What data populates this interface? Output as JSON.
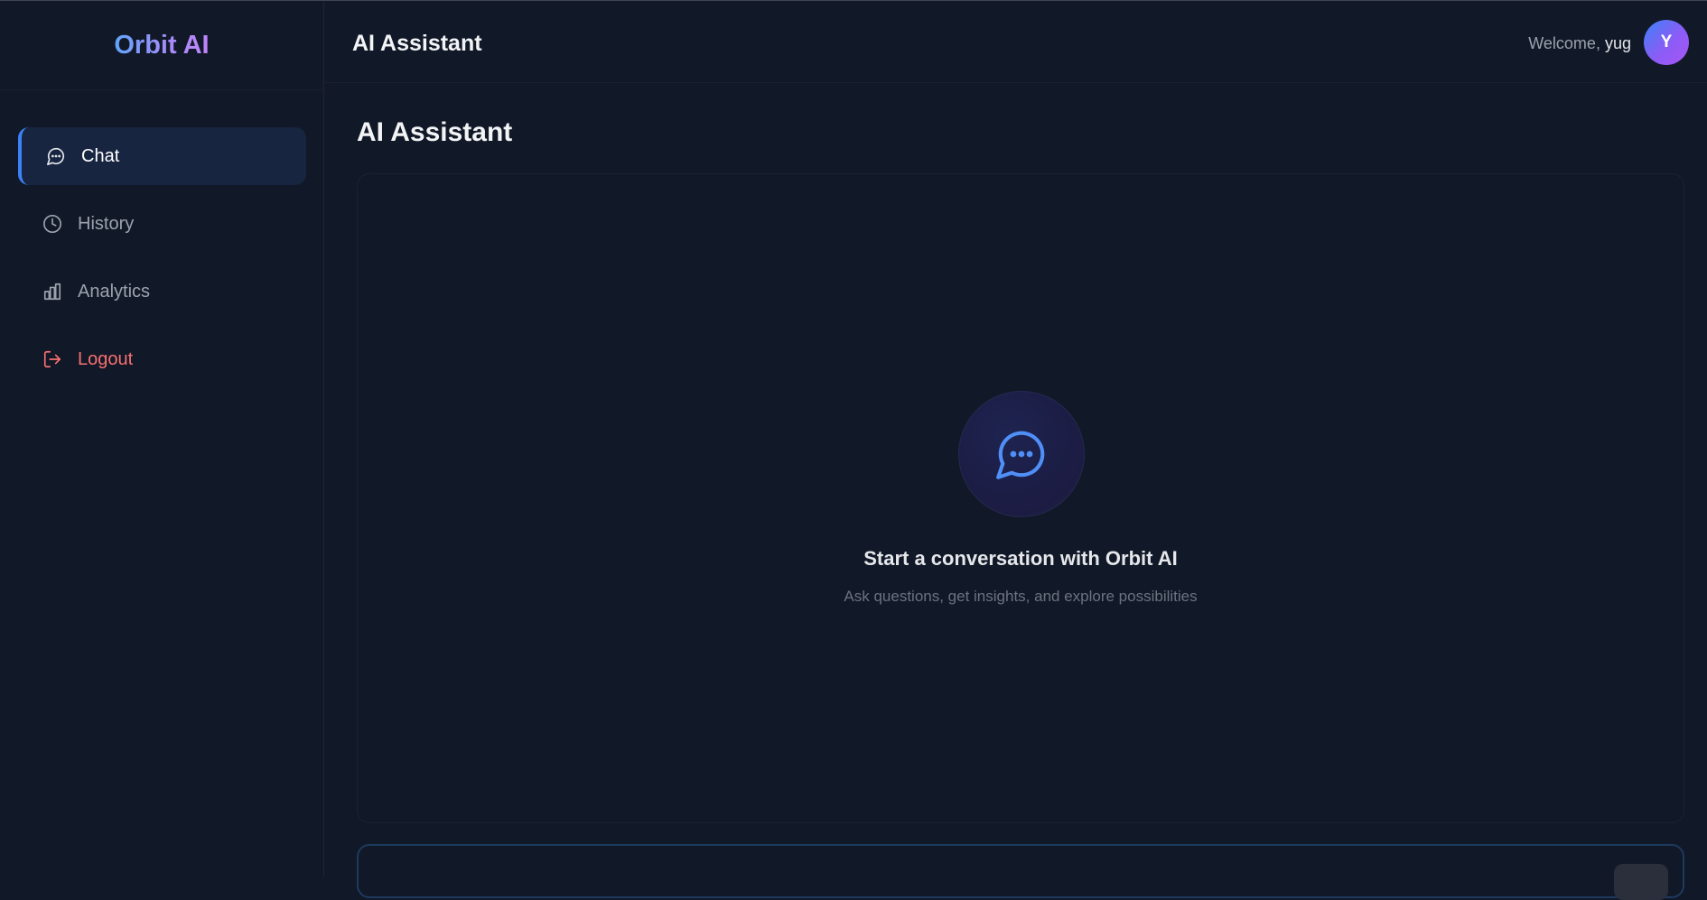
{
  "brand": {
    "name": "Orbit AI"
  },
  "sidebar": {
    "items": [
      {
        "label": "Chat",
        "icon": "chat-icon",
        "active": true
      },
      {
        "label": "History",
        "icon": "clock-icon",
        "active": false
      },
      {
        "label": "Analytics",
        "icon": "bar-chart-icon",
        "active": false
      },
      {
        "label": "Logout",
        "icon": "logout-icon",
        "active": false
      }
    ]
  },
  "header": {
    "title": "AI Assistant",
    "welcome_prefix": "Welcome,",
    "username": "yug",
    "avatar_initial": "Y"
  },
  "main": {
    "title": "AI Assistant",
    "empty_state": {
      "icon": "chat-bubble-icon",
      "title": "Start a conversation with Orbit AI",
      "subtitle": "Ask questions, get insights, and explore possibilities"
    }
  },
  "colors": {
    "background": "#111827",
    "accent": "#3b82f6",
    "danger": "#f87171",
    "active_bg": "#172541"
  }
}
